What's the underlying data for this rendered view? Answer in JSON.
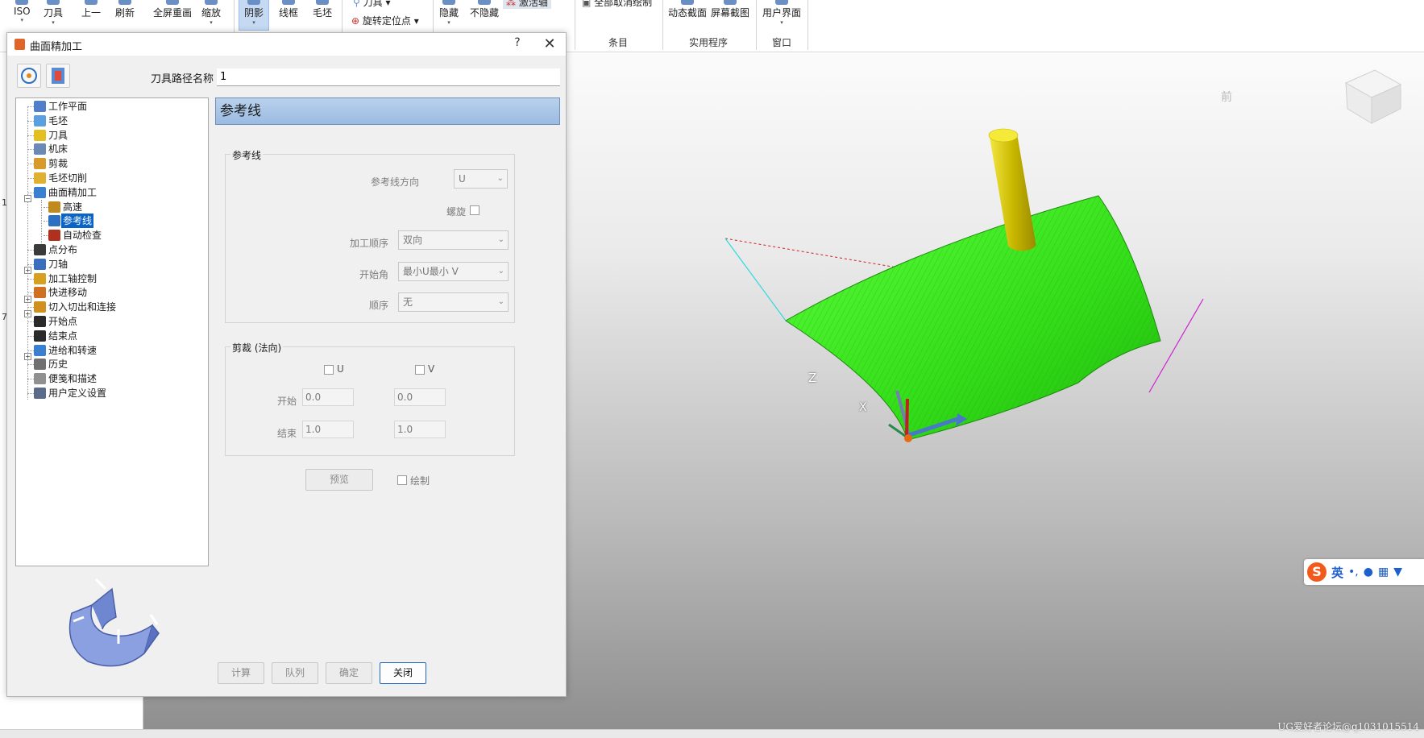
{
  "ribbon": {
    "buttons": [
      "ISO",
      "刀具",
      "上一",
      "刷新",
      "全屏重画",
      "缩放",
      "阴影",
      "线框",
      "毛坯",
      "刀具",
      "旋转定位点",
      "隐藏",
      "不隐藏",
      "激活轴",
      "全部取消绘制",
      "动态截面",
      "屏幕截图",
      "用户界面"
    ],
    "groups": [
      "条目",
      "实用程序",
      "窗口"
    ],
    "pressed_color": "#c5daf2"
  },
  "left_strip": {
    "marks": [
      "1",
      "7"
    ]
  },
  "dialog": {
    "title": "曲面精加工",
    "help": "?",
    "close": "✕",
    "toolpath_name_label": "刀具路径名称",
    "toolpath_name_value": "1",
    "section_title": "参考线",
    "tree": [
      {
        "label": "工作平面",
        "icon": "workplane-icon",
        "color": "#4f7fc8"
      },
      {
        "label": "毛坯",
        "icon": "block-icon",
        "color": "#5aa0e0"
      },
      {
        "label": "刀具",
        "icon": "tool-icon",
        "color": "#e3c020"
      },
      {
        "label": "机床",
        "icon": "machine-icon",
        "color": "#6c89b6"
      },
      {
        "label": "剪裁",
        "icon": "limit-icon",
        "color": "#d89a2a"
      },
      {
        "label": "毛坯切削",
        "icon": "stock-cut-icon",
        "color": "#e0b030"
      },
      {
        "label": "曲面精加工",
        "icon": "surface-finish-icon",
        "color": "#3a7fd0"
      },
      {
        "label": "高速",
        "icon": "high-speed-icon",
        "color": "#c08a20"
      },
      {
        "label": "参考线",
        "icon": "reference-line-icon",
        "color": "#2d6fc0"
      },
      {
        "label": "自动检查",
        "icon": "auto-check-icon",
        "color": "#b03020"
      },
      {
        "label": "点分布",
        "icon": "point-distribution-icon",
        "color": "#3a3a3a"
      },
      {
        "label": "刀轴",
        "icon": "tool-axis-icon",
        "color": "#3a6fc0"
      },
      {
        "label": "加工轴控制",
        "icon": "axis-control-icon",
        "color": "#d8a020"
      },
      {
        "label": "快进移动",
        "icon": "rapid-move-icon",
        "color": "#d07020"
      },
      {
        "label": "切入切出和连接",
        "icon": "leads-links-icon",
        "color": "#d09020"
      },
      {
        "label": "开始点",
        "icon": "start-point-icon",
        "color": "#2a2a2a"
      },
      {
        "label": "结束点",
        "icon": "end-point-icon",
        "color": "#2a2a2a"
      },
      {
        "label": "进给和转速",
        "icon": "feeds-speeds-icon",
        "color": "#3a7fd0"
      },
      {
        "label": "历史",
        "icon": "history-icon",
        "color": "#707070"
      },
      {
        "label": "便笺和描述",
        "icon": "notes-icon",
        "color": "#909090"
      },
      {
        "label": "用户定义设置",
        "icon": "user-settings-icon",
        "color": "#5a6a8a"
      }
    ],
    "reference_group": {
      "title": "参考线",
      "direction_label": "参考线方向",
      "direction_value": "U",
      "spiral_label": "螺旋",
      "order_label": "加工顺序",
      "order_value": "双向",
      "start_corner_label": "开始角",
      "start_corner_value": "最小U最小 V",
      "sequence_label": "顺序",
      "sequence_value": "无"
    },
    "trim_group": {
      "title": "剪裁 (法向)",
      "u_label": "U",
      "v_label": "V",
      "start_label": "开始",
      "end_label": "结束",
      "u_start": "0.0",
      "v_start": "0.0",
      "u_end": "1.0",
      "v_end": "1.0"
    },
    "preview_button": "预览",
    "draw_label": "绘制",
    "buttons": {
      "calculate": "计算",
      "queue": "队列",
      "ok": "确定",
      "close": "关闭"
    }
  },
  "viewport": {
    "axis_labels": {
      "z": "Z",
      "x": "X"
    },
    "view_cube": "前",
    "surface_color": "#35e01a",
    "tool_color": "#d8c800"
  },
  "ime": {
    "logo": "S",
    "lang": "英",
    "punct": "•,",
    "icons": [
      "mic-icon",
      "keyboard-icon",
      "shirt-icon"
    ]
  },
  "watermark": "UG爱好者论坛@q1031015514"
}
